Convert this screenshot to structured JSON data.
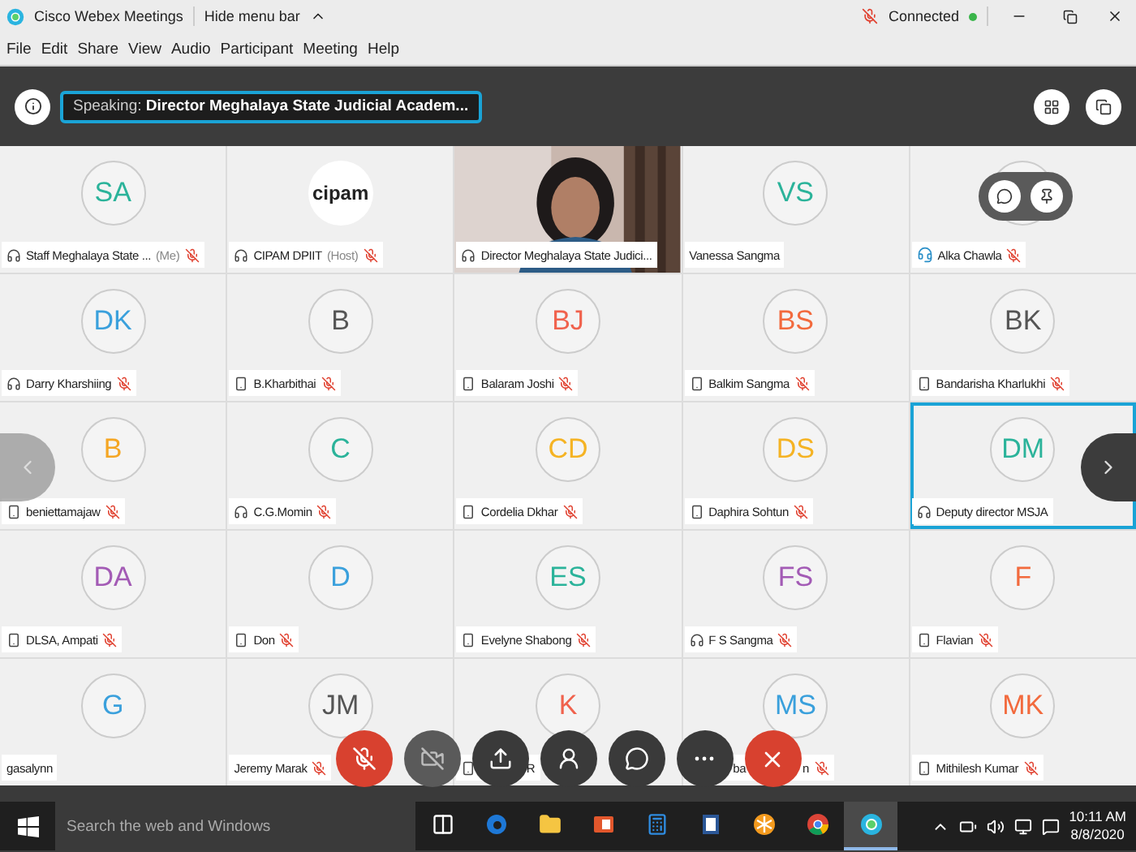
{
  "window": {
    "title": "Cisco Webex Meetings",
    "hide_menu": "Hide menu bar",
    "status": "Connected"
  },
  "menu": [
    "File",
    "Edit",
    "Share",
    "View",
    "Audio",
    "Participant",
    "Meeting",
    "Help"
  ],
  "speaking": "Speaking: **Director Meghalaya State Judicial Academ...**",
  "tiles": [
    {
      "kind": "avatar",
      "initials": "SA",
      "color": "#2bb39a",
      "name": "Staff Meghalaya State ...",
      "role": "(Me)",
      "device": {
        "kind": "headset"
      },
      "muted": true,
      "selected": false
    },
    {
      "kind": "logo",
      "initials": "cipam",
      "name": "CIPAM DPIIT",
      "role": "(Host)",
      "device": {
        "kind": "headset"
      },
      "muted": true,
      "selected": false
    },
    {
      "kind": "picture",
      "name": "Director Meghalaya State Judici...",
      "device": {
        "kind": "headset"
      },
      "muted": false,
      "selected": false
    },
    {
      "kind": "avatar",
      "initials": "VS",
      "color": "#2bb39a",
      "name": "Vanessa Sangma",
      "muted": false,
      "selected": false
    },
    {
      "kind": "hover",
      "name": "Alka Chawla",
      "device": {
        "kind": "headset-phone"
      },
      "muted": true,
      "selected": false
    },
    {
      "kind": "avatar",
      "initials": "DK",
      "color": "#3aa0dc",
      "name": "Darry Kharshiing",
      "device": {
        "kind": "headset"
      },
      "muted": true,
      "selected": false
    },
    {
      "kind": "avatar",
      "initials": "B",
      "color": "#555555",
      "name": "B.Kharbithai",
      "device": {
        "kind": "phone"
      },
      "muted": true,
      "selected": false
    },
    {
      "kind": "avatar",
      "initials": "BJ",
      "color": "#f0624d",
      "name": "Balaram Joshi",
      "device": {
        "kind": "phone"
      },
      "muted": true,
      "selected": false
    },
    {
      "kind": "avatar",
      "initials": "BS",
      "color": "#f26a3d",
      "name": "Balkim Sangma",
      "device": {
        "kind": "phone"
      },
      "muted": true,
      "selected": false
    },
    {
      "kind": "avatar",
      "initials": "BK",
      "color": "#555555",
      "name": "Bandarisha Kharlukhi",
      "device": {
        "kind": "phone"
      },
      "muted": true,
      "selected": false
    },
    {
      "kind": "avatar",
      "initials": "B",
      "color": "#f5a623",
      "name": "beniettamajaw",
      "device": {
        "kind": "phone"
      },
      "muted": true,
      "selected": false
    },
    {
      "kind": "avatar",
      "initials": "C",
      "color": "#2bb39a",
      "name": "C.G.Momin",
      "device": {
        "kind": "headset"
      },
      "muted": true,
      "selected": false
    },
    {
      "kind": "avatar",
      "initials": "CD",
      "color": "#f5b323",
      "name": "Cordelia Dkhar",
      "device": {
        "kind": "phone"
      },
      "muted": true,
      "selected": false
    },
    {
      "kind": "avatar",
      "initials": "DS",
      "color": "#f5b323",
      "name": "Daphira Sohtun",
      "device": {
        "kind": "phone"
      },
      "muted": true,
      "selected": false
    },
    {
      "kind": "avatar",
      "initials": "DM",
      "color": "#2bb39a",
      "name": "Deputy director MSJA",
      "device": {
        "kind": "headset"
      },
      "muted": false,
      "selected": true
    },
    {
      "kind": "avatar",
      "initials": "DA",
      "color": "#a35bb5",
      "name": "DLSA, Ampati",
      "device": {
        "kind": "phone"
      },
      "muted": true,
      "selected": false
    },
    {
      "kind": "avatar",
      "initials": "D",
      "color": "#3aa0dc",
      "name": "Don",
      "device": {
        "kind": "phone"
      },
      "muted": true,
      "selected": false
    },
    {
      "kind": "avatar",
      "initials": "ES",
      "color": "#2bb39a",
      "name": "Evelyne Shabong",
      "device": {
        "kind": "phone"
      },
      "muted": true,
      "selected": false
    },
    {
      "kind": "avatar",
      "initials": "FS",
      "color": "#a35bb5",
      "name": "F S Sangma",
      "device": {
        "kind": "headset"
      },
      "muted": true,
      "selected": false
    },
    {
      "kind": "avatar",
      "initials": "F",
      "color": "#f26a3d",
      "name": "Flavian",
      "device": {
        "kind": "phone"
      },
      "muted": true,
      "selected": false
    },
    {
      "kind": "avatar",
      "initials": "G",
      "color": "#3aa0dc",
      "name": "gasalynn",
      "muted": false,
      "selected": false
    },
    {
      "kind": "avatar",
      "initials": "JM",
      "color": "#555555",
      "name": "Jeremy Marak",
      "muted": true,
      "selected": false
    },
    {
      "kind": "avatar",
      "initials": "K",
      "color": "#f0624d",
      "name": "R",
      "covered": true,
      "device": {
        "kind": "phone"
      },
      "muted": false,
      "selected": false
    },
    {
      "kind": "avatar",
      "initials": "MS",
      "color": "#3aa0dc",
      "name": "ba",
      "name_tail": "n",
      "covered": true,
      "muted": true,
      "selected": false
    },
    {
      "kind": "avatar",
      "initials": "MK",
      "color": "#f26a3d",
      "name": "Mithilesh Kumar",
      "device": {
        "kind": "phone"
      },
      "muted": true,
      "selected": false
    }
  ],
  "controls": [
    {
      "kind": "mute"
    },
    {
      "kind": "video"
    },
    {
      "kind": "share"
    },
    {
      "kind": "participants"
    },
    {
      "kind": "chat"
    },
    {
      "kind": "more"
    },
    {
      "kind": "leave"
    }
  ],
  "taskbar": {
    "search": {
      "placeholder": "Search the web and Windows"
    },
    "apps": [
      {
        "kind": "taskview",
        "selected": false
      },
      {
        "kind": "edge",
        "selected": false
      },
      {
        "kind": "explorer",
        "selected": false
      },
      {
        "kind": "office",
        "selected": false
      },
      {
        "kind": "calculator",
        "selected": false
      },
      {
        "kind": "word",
        "selected": false
      },
      {
        "kind": "snowflake",
        "selected": false
      },
      {
        "kind": "chrome",
        "selected": false
      },
      {
        "kind": "webex",
        "selected": true
      }
    ],
    "time": "10:11 AM",
    "date": "8/8/2020"
  }
}
